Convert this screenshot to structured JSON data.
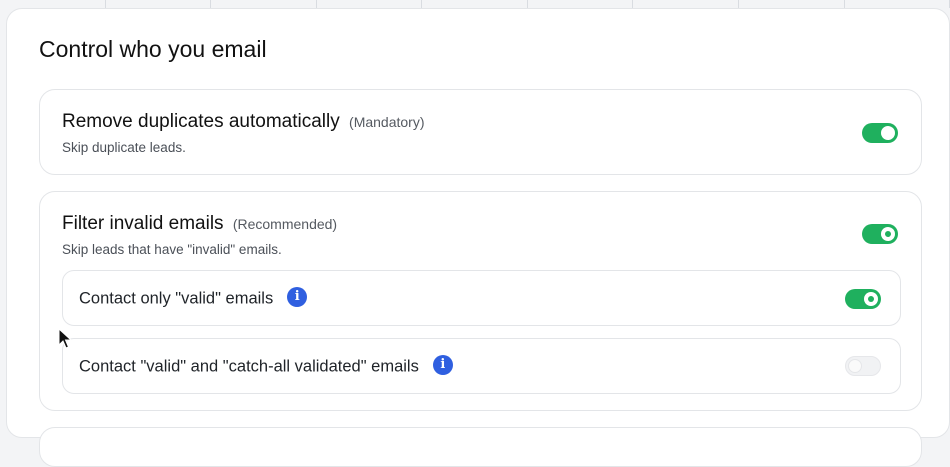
{
  "section": {
    "title": "Control who you email"
  },
  "cards": {
    "duplicates": {
      "title": "Remove duplicates automatically",
      "tag": "(Mandatory)",
      "subtitle": "Skip duplicate leads.",
      "toggle_on": true
    },
    "invalid": {
      "title": "Filter invalid emails",
      "tag": "(Recommended)",
      "subtitle": "Skip leads that have \"invalid\" emails.",
      "toggle_on": true,
      "options": [
        {
          "label": "Contact only \"valid\" emails",
          "info_icon": "info-icon",
          "toggle_on": true
        },
        {
          "label": "Contact \"valid\" and \"catch-all validated\" emails",
          "info_icon": "info-icon",
          "toggle_on": false
        }
      ]
    }
  },
  "colors": {
    "toggle_on": "#1fb05e",
    "info_icon": "#2f5fe0"
  },
  "icons": {
    "info": "i"
  }
}
